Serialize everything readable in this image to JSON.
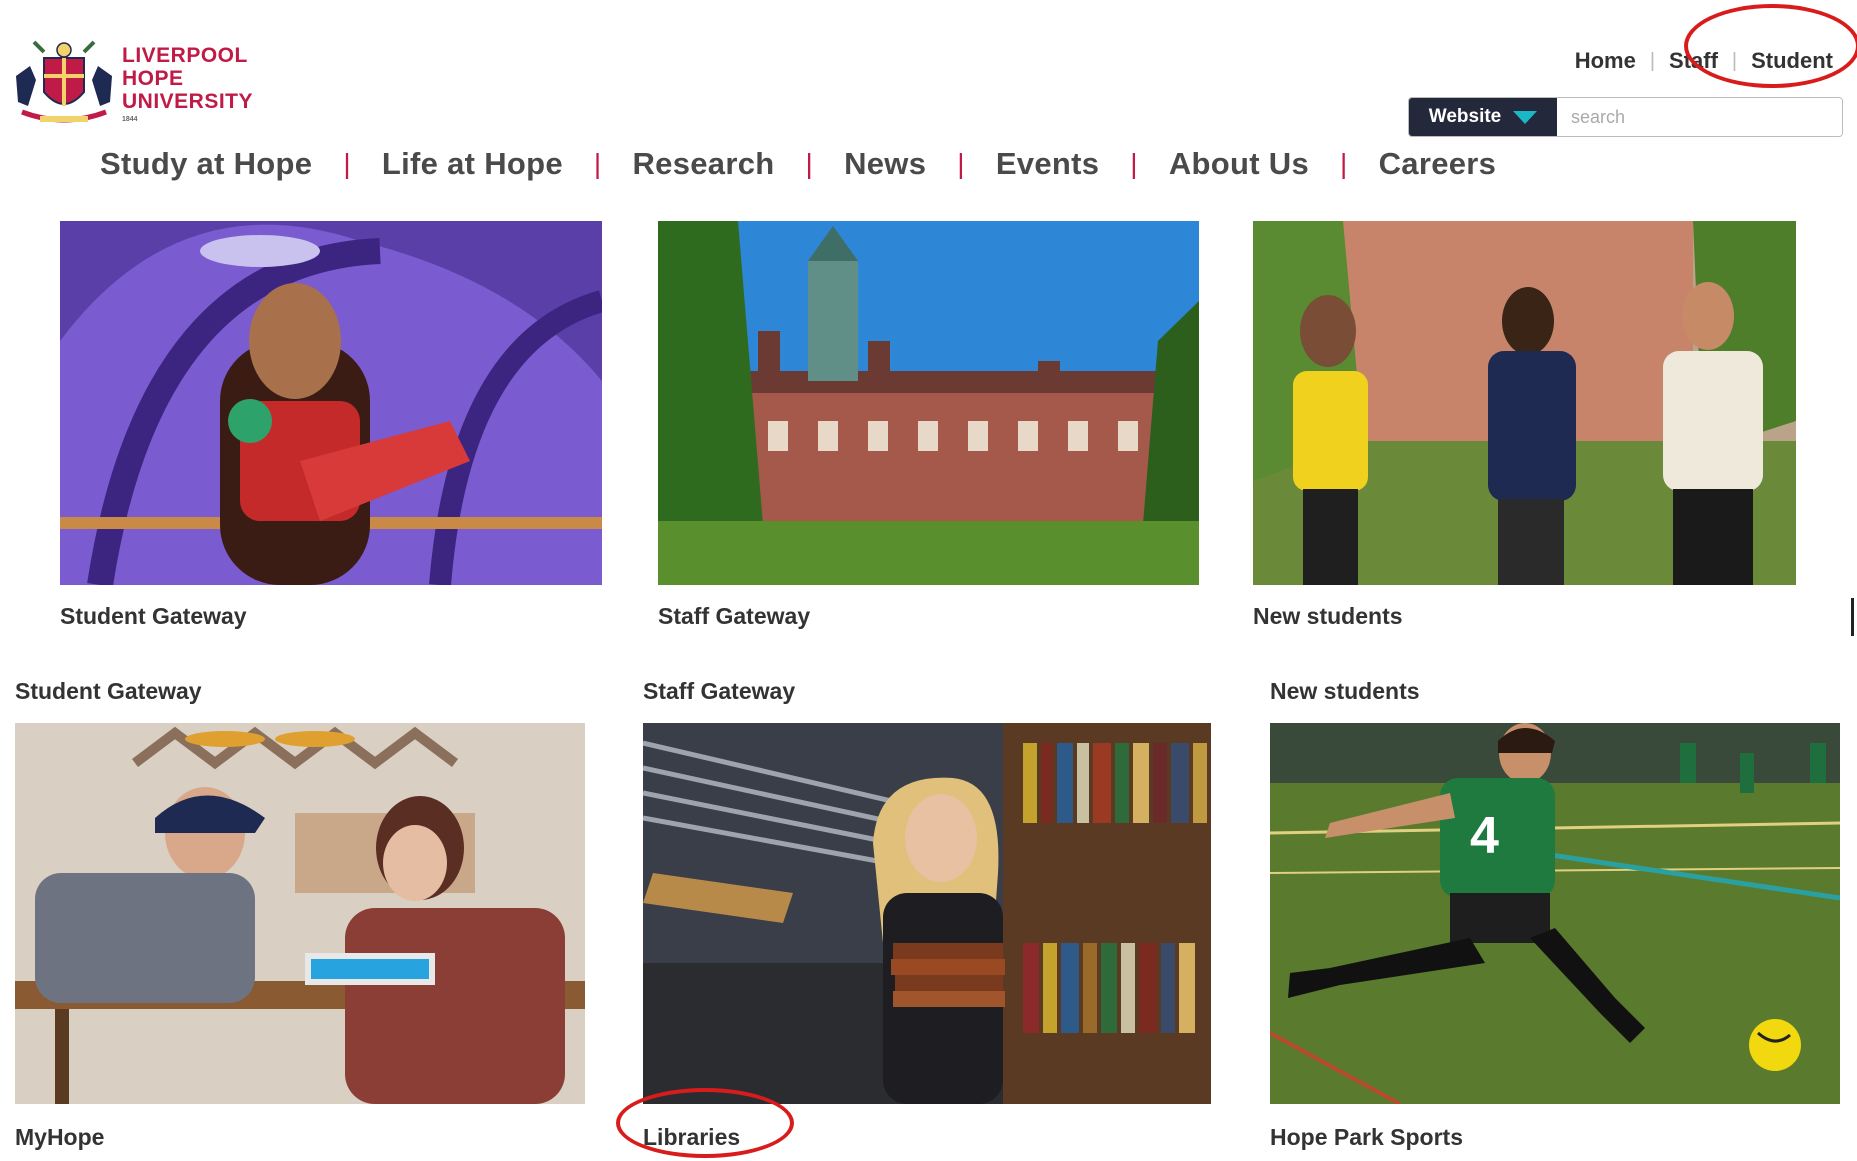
{
  "logo": {
    "line1": "LIVERPOOL",
    "line2": "HOPE",
    "line3": "UNIVERSITY",
    "est": "1844"
  },
  "utility_nav": {
    "home": "Home",
    "staff": "Staff",
    "student": "Student",
    "separator": "|"
  },
  "search": {
    "scope_label": "Website",
    "placeholder": "search",
    "value": ""
  },
  "main_nav": [
    "Study at Hope",
    "Life at Hope",
    "Research",
    "News",
    "Events",
    "About Us",
    "Careers"
  ],
  "main_nav_separator": "|",
  "top_tiles": [
    {
      "caption": "Student Gateway",
      "image": "student-reading-photo"
    },
    {
      "caption": "Staff Gateway",
      "image": "campus-building-photo"
    },
    {
      "caption": "New students",
      "image": "students-walking-photo"
    }
  ],
  "bottom_tiles": [
    {
      "heading": "Student Gateway",
      "caption": "MyHope",
      "image": "students-cafe-laptop-photo"
    },
    {
      "heading": "Staff Gateway",
      "caption": "Libraries",
      "image": "library-student-books-photo"
    },
    {
      "heading": "New students",
      "caption": "Hope Park Sports",
      "image": "football-player-photo"
    }
  ],
  "colors": {
    "brand": "#c01a47",
    "search_scope_bg": "#23283a",
    "search_arrow": "#1ab7c7",
    "annotation": "#d81c1c"
  },
  "annotations": [
    "circle around Student link",
    "circle around Libraries caption"
  ]
}
